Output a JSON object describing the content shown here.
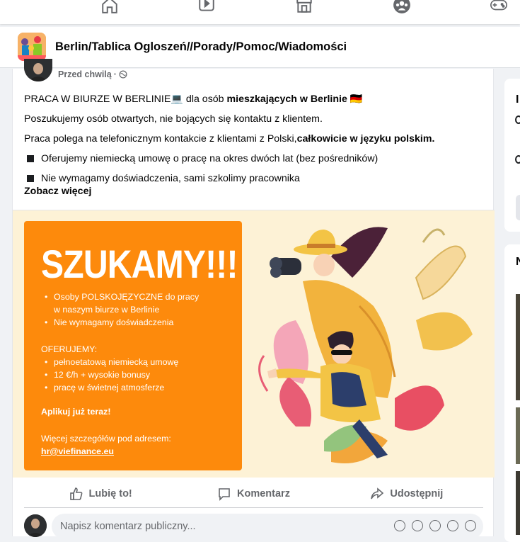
{
  "nav": {
    "icons": [
      "home-icon",
      "watch-icon",
      "marketplace-icon",
      "groups-icon",
      "gaming-icon"
    ]
  },
  "group": {
    "name": "Berlin/Tablica Ogloszeń//Porady/Pomoc/Wiadomości"
  },
  "post": {
    "timestamp": "Przed chwilą",
    "separator": "·",
    "line1_prefix": "PRACA W BIURZE W BERLINIE💻 dla osób ",
    "line1_bold": "mieszkających w Berlinie",
    "line1_suffix": " 🇩🇪",
    "line2": "Poszukujemy osób otwartych, nie bojących się kontaktu z klientem.",
    "line3_prefix": "Praca polega na telefonicznym kontakcie z klientami z Polski,",
    "line3_bold": "całkowicie w języku polskim.",
    "bullet1": "Oferujemy niemiecką umowę o pracę na okres dwóch lat (bez pośredników)",
    "bullet2": "Nie wymagamy doświadczenia, sami szkolimy pracownika",
    "see_more": "Zobacz więcej"
  },
  "ad": {
    "headline": "SZUKAMY!!!",
    "requirements": [
      "Osoby POLSKOJĘZYCZNE do pracy w naszym biurze w Berlinie",
      "Nie wymagamy doświadczenia"
    ],
    "offer_title": "OFERUJEMY:",
    "offer": [
      "pełnoetatową niemiecką umowę",
      "12 €/h + wysokie bonusy",
      "pracę w świetnej atmosferze"
    ],
    "apply": "Aplikuj już teraz!",
    "more_info": "Więcej szczegółów pod adresem:",
    "email": "hr@viefinance.eu"
  },
  "actions": {
    "like": "Lubię to!",
    "comment": "Komentarz",
    "share": "Udostępnij"
  },
  "comment_box": {
    "placeholder": "Napisz komentarz publiczny..."
  },
  "sidebar": {
    "card1_letter": "I",
    "card2_letter": "N"
  },
  "colors": {
    "accent_orange": "#fd8a0c",
    "image_bg": "#fdf2d6",
    "muted_text": "#65676b"
  }
}
